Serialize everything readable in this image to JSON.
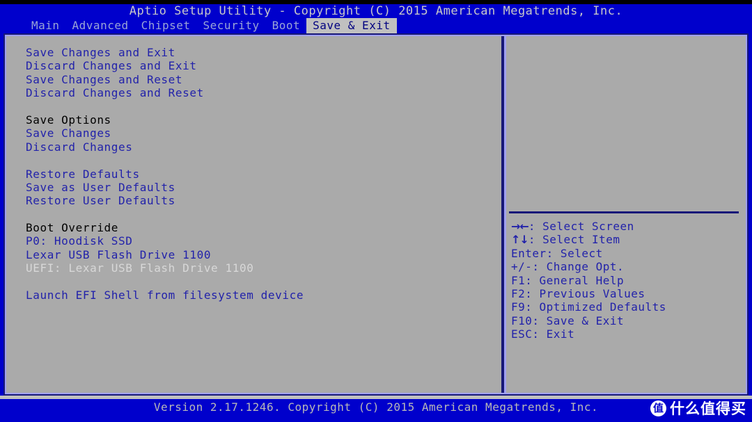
{
  "colors": {
    "screen_blue": "#0000cc",
    "panel_grey": "#aaaaaa",
    "border_navy": "#181878",
    "border_highlight": "#a0a0f0",
    "option_blue": "#2222aa",
    "header_black": "#000000",
    "disabled_grey": "#d8d8d8",
    "title_text": "#c8c8c8",
    "tab_inactive": "#9aa5d6",
    "tab_active_bg": "#c0c0c0",
    "tab_active_text": "#000080"
  },
  "header": {
    "title": "Aptio Setup Utility - Copyright (C) 2015 American Megatrends, Inc."
  },
  "menu": {
    "tabs": [
      {
        "label": "Main",
        "active": false
      },
      {
        "label": "Advanced",
        "active": false
      },
      {
        "label": "Chipset",
        "active": false
      },
      {
        "label": "Security",
        "active": false
      },
      {
        "label": "Boot",
        "active": false
      },
      {
        "label": "Save & Exit",
        "active": true
      }
    ]
  },
  "main": {
    "options": [
      {
        "label": "Save Changes and Exit",
        "style": "item"
      },
      {
        "label": "Discard Changes and Exit",
        "style": "item"
      },
      {
        "label": "Save Changes and Reset",
        "style": "item"
      },
      {
        "label": "Discard Changes and Reset",
        "style": "item"
      },
      {
        "label": "",
        "style": "spacer"
      },
      {
        "label": "Save Options",
        "style": "header"
      },
      {
        "label": "Save Changes",
        "style": "item"
      },
      {
        "label": "Discard Changes",
        "style": "item"
      },
      {
        "label": "",
        "style": "spacer"
      },
      {
        "label": "Restore Defaults",
        "style": "item"
      },
      {
        "label": "Save as User Defaults",
        "style": "item"
      },
      {
        "label": "Restore User Defaults",
        "style": "item"
      },
      {
        "label": "",
        "style": "spacer"
      },
      {
        "label": "Boot Override",
        "style": "header"
      },
      {
        "label": "P0: Hoodisk SSD",
        "style": "item"
      },
      {
        "label": "Lexar USB Flash Drive 1100",
        "style": "item"
      },
      {
        "label": "UEFI: Lexar USB Flash Drive 1100",
        "style": "disabled"
      },
      {
        "label": "",
        "style": "spacer"
      },
      {
        "label": "Launch EFI Shell from filesystem device",
        "style": "item"
      }
    ]
  },
  "help": {
    "description": "",
    "legend": [
      {
        "glyph": "→←",
        "text": ": Select Screen"
      },
      {
        "glyph": "↑↓",
        "text": ": Select Item"
      },
      {
        "glyph": "",
        "text": "Enter: Select"
      },
      {
        "glyph": "",
        "text": "+/-: Change Opt."
      },
      {
        "glyph": "",
        "text": "F1: General Help"
      },
      {
        "glyph": "",
        "text": "F2: Previous Values"
      },
      {
        "glyph": "",
        "text": "F9: Optimized Defaults"
      },
      {
        "glyph": "",
        "text": "F10: Save & Exit"
      },
      {
        "glyph": "",
        "text": "ESC: Exit"
      }
    ]
  },
  "footer": {
    "version_text": "Version 2.17.1246. Copyright (C) 2015 American Megatrends, Inc."
  },
  "watermark": {
    "logo_char": "值",
    "text": "什么值得买"
  }
}
